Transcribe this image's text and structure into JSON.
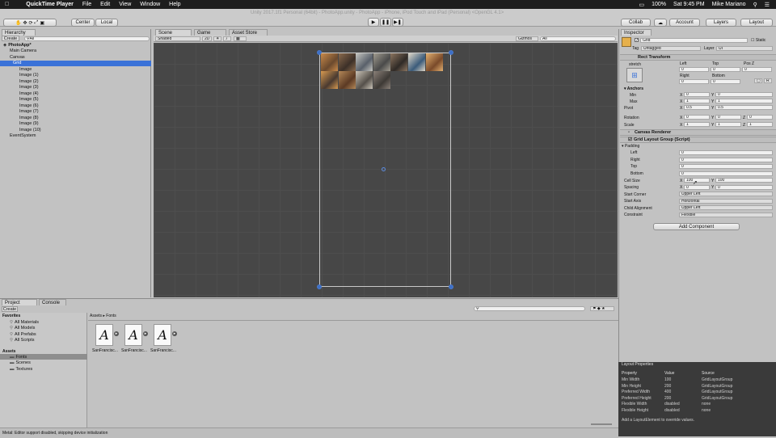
{
  "menubar": {
    "apple": "",
    "app": "QuickTime Player",
    "items": [
      "File",
      "Edit",
      "View",
      "Window",
      "Help"
    ],
    "battery": "100%",
    "time": "Sat 9:45 PM",
    "user": "Mike Mariano"
  },
  "window_title": "Unity 2017.1f1 Personal (64bit) - PhotoApp.unity - PhotoApp - iPhone, iPod Touch and iPad (Personal) <OpenGL 4.1>",
  "toolbar": {
    "center": "Center",
    "local": "Local",
    "collab": "Collab",
    "account": "Account",
    "layers": "Layers",
    "layout": "Layout"
  },
  "hierarchy": {
    "tab": "Hierarchy",
    "create": "Create",
    "search": "All",
    "items": [
      "PhotoApp*",
      "Main Camera",
      "Canvas",
      "Grid",
      "Image",
      "Image (1)",
      "Image (2)",
      "Image (3)",
      "Image (4)",
      "Image (5)",
      "Image (6)",
      "Image (7)",
      "Image (8)",
      "Image (9)",
      "Image (10)",
      "EventSystem"
    ]
  },
  "scene": {
    "tabs": [
      "Scene",
      "Game",
      "Asset Store"
    ],
    "shaded": "Shaded",
    "mode2d": "2D",
    "gizmos": "Gizmos",
    "search": "All"
  },
  "photos": [
    {
      "c1": "#6b4a2e",
      "c2": "#c98a4a"
    },
    {
      "c1": "#3c3028",
      "c2": "#8a6a4c"
    },
    {
      "c1": "#59606a",
      "c2": "#c6c6c0"
    },
    {
      "c1": "#4a4a4a",
      "c2": "#a19c90"
    },
    {
      "c1": "#2f2a26",
      "c2": "#8c7560"
    },
    {
      "c1": "#3b5b7a",
      "c2": "#e0d8c8"
    },
    {
      "c1": "#7a4a2a",
      "c2": "#e2b070"
    },
    {
      "c1": "#4a3a30",
      "c2": "#d89a50"
    },
    {
      "c1": "#5c3a24",
      "c2": "#b48858"
    },
    {
      "c1": "#55504a",
      "c2": "#cbc4b8"
    },
    {
      "c1": "#3e3a36",
      "c2": "#8a8078"
    }
  ],
  "inspector": {
    "tab": "Inspector",
    "name": "Grid",
    "static": "Static",
    "tag_label": "Tag",
    "tag": "Untagged",
    "layer_label": "Layer",
    "layer": "UI",
    "rect": "Rect Transform",
    "stretch": "stretch",
    "pos_headers": [
      "Left",
      "Top",
      "Pos Z"
    ],
    "pos_values": [
      "0",
      "0",
      "0"
    ],
    "size_headers": [
      "Right",
      "Bottom"
    ],
    "size_values": [
      "0",
      "0"
    ],
    "anchors": "Anchors",
    "min": "Min",
    "max": "Max",
    "pivot": "Pivot",
    "min_x": "0",
    "min_y": "0",
    "max_x": "1",
    "max_y": "1",
    "pivot_x": "0.5",
    "pivot_y": "0.5",
    "rotation": "Rotation",
    "scale": "Scale",
    "rot_x": "0",
    "rot_y": "0",
    "rot_z": "0",
    "scale_x": "1",
    "scale_y": "1",
    "scale_z": "1",
    "canvas_renderer": "Canvas Renderer",
    "grid_layout": "Grid Layout Group (Script)",
    "padding": "Padding",
    "left": "Left",
    "right": "Right",
    "top": "Top",
    "bottom": "Bottom",
    "pad_left": "0",
    "pad_right": "0",
    "pad_top": "0",
    "pad_bottom": "0",
    "cell_size": "Cell Size",
    "cell_x": "100",
    "cell_y": "100",
    "spacing": "Spacing",
    "sp_x": "0",
    "sp_y": "0",
    "start_corner": "Start Corner",
    "start_corner_v": "Upper Left",
    "start_axis": "Start Axis",
    "start_axis_v": "Horizontal",
    "child_align": "Child Alignment",
    "child_align_v": "Upper Left",
    "constraint": "Constraint",
    "constraint_v": "Flexible",
    "add_component": "Add Component",
    "x": "X",
    "y": "Y",
    "z": "Z",
    "r": "R"
  },
  "layout_props": {
    "title": "Layout Properties",
    "headers": [
      "Property",
      "Value",
      "Source"
    ],
    "rows": [
      [
        "Min Width",
        "100",
        "GridLayoutGroup"
      ],
      [
        "Min Height",
        "200",
        "GridLayoutGroup"
      ],
      [
        "Preferred Width",
        "400",
        "GridLayoutGroup"
      ],
      [
        "Preferred Height",
        "200",
        "GridLayoutGroup"
      ],
      [
        "Flexible Width",
        "disabled",
        "none"
      ],
      [
        "Flexible Height",
        "disabled",
        "none"
      ]
    ],
    "footer": "Add a LayoutElement to override values."
  },
  "project": {
    "tabs": [
      "Project",
      "Console"
    ],
    "create": "Create",
    "favorites": "Favorites",
    "fav_items": [
      "All Materials",
      "All Models",
      "All Prefabs",
      "All Scripts"
    ],
    "assets": "Assets",
    "asset_items": [
      "Fonts",
      "Scenes",
      "Textures"
    ],
    "breadcrumb": "Assets ▸ Fonts",
    "fonts": [
      "SanFrancisc...",
      "SanFrancisc...",
      "SanFrancisc..."
    ]
  },
  "status": "Metal: Editor support disabled, skipping device initialization"
}
